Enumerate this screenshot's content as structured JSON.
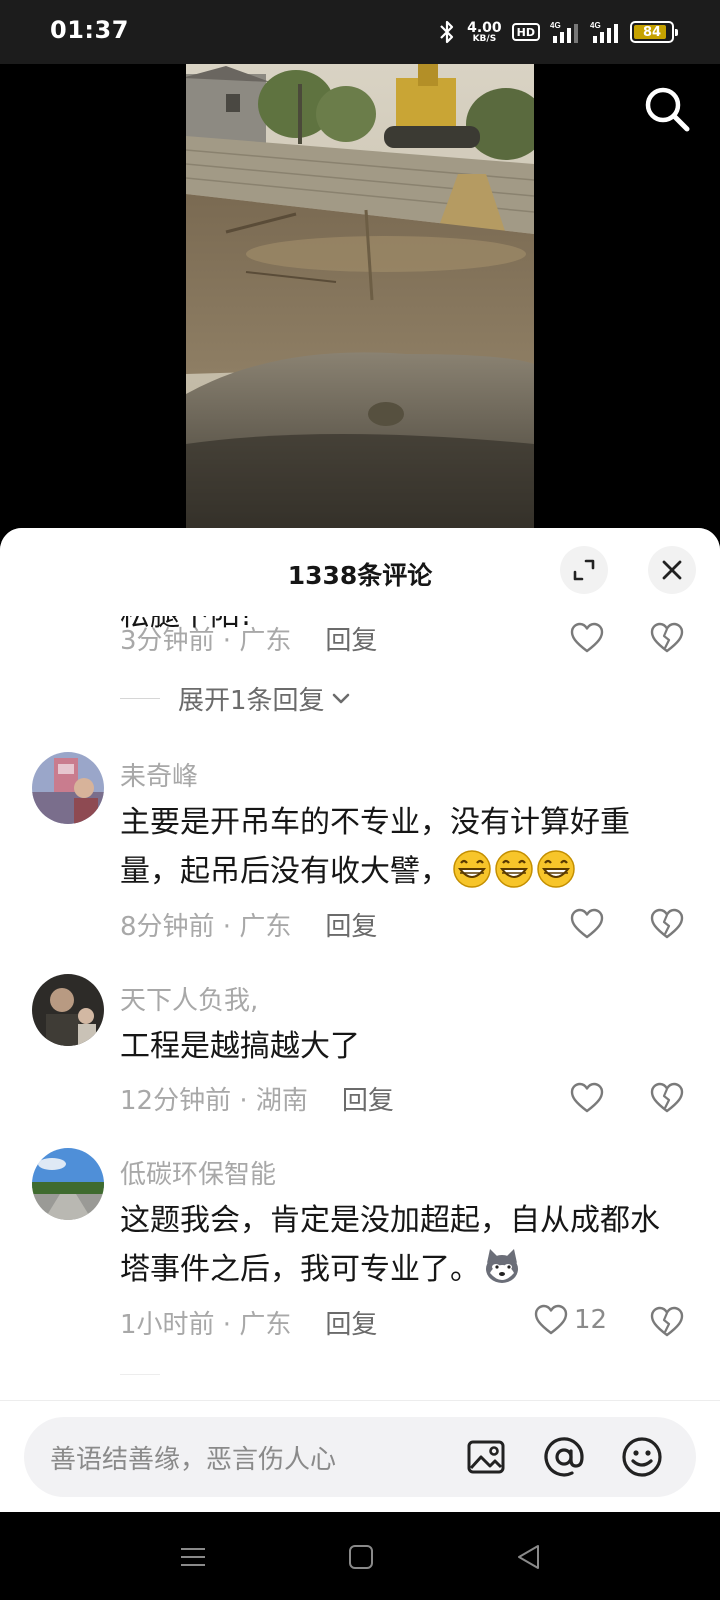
{
  "status_bar": {
    "time": "01:37",
    "net_speed_value": "4.00",
    "net_speed_unit": "KB/S",
    "hd_label": "HD",
    "battery_level": "84",
    "battery_color": "#c6a200",
    "icons": [
      "bluetooth-icon",
      "hd-voice-icon",
      "signal-4g-icon",
      "signal-4g-icon",
      "battery-icon"
    ]
  },
  "video": {
    "icons": [
      "search-icon"
    ]
  },
  "comments_panel": {
    "title": "1338条评论",
    "icons": [
      "expand-icon",
      "close-icon"
    ],
    "partial_text": "松腿下阳!",
    "top_meta": {
      "time_location": "3分钟前 · 广东",
      "reply": "回复"
    },
    "expand_replies": "展开1条回复",
    "comments": [
      {
        "username": "耒奇峰",
        "text": "主要是开吊车的不专业，没有计算好重量，起吊后没有收大譬，",
        "emojis": [
          "grin-emoji",
          "grin-emoji",
          "grin-emoji"
        ],
        "time_location": "8分钟前 · 广东",
        "reply": "回复",
        "likes": ""
      },
      {
        "username": "天下人负我,",
        "text": "工程是越搞越大了",
        "emojis": [],
        "time_location": "12分钟前 · 湖南",
        "reply": "回复",
        "likes": ""
      },
      {
        "username": "低碳环保智能",
        "text": "这题我会，肯定是没加超起，自从成都水塔事件之后，我可专业了。",
        "emojis": [
          "husky-emoji"
        ],
        "time_location": "1小时前 · 广东",
        "reply": "回复",
        "likes": "12"
      }
    ]
  },
  "input_bar": {
    "placeholder": "善语结善缘，恶言伤人心",
    "icons": [
      "image-icon",
      "at-icon",
      "emoji-icon"
    ]
  },
  "nav_bar": {
    "icons": [
      "menu-icon",
      "home-icon",
      "back-icon"
    ]
  }
}
